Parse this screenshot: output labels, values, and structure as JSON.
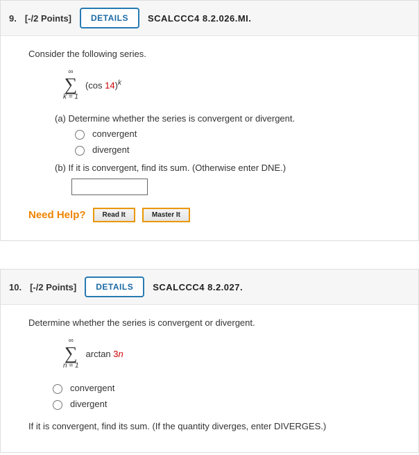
{
  "q9": {
    "number": "9.",
    "points": "[-/2 Points]",
    "details": "DETAILS",
    "ref": "SCALCCC4 8.2.026.MI.",
    "prompt": "Consider the following series.",
    "sigma": {
      "top": "∞",
      "bottom": "k = 1"
    },
    "expr_prefix": "(cos ",
    "expr_num": "14",
    "expr_suffix": ")",
    "expr_sup": "k",
    "partA": "(a) Determine whether the series is convergent or divergent.",
    "optConv": "convergent",
    "optDiv": "divergent",
    "partB": "(b) If it is convergent, find its sum. (Otherwise enter DNE.)",
    "needHelp": "Need Help?",
    "readIt": "Read It",
    "masterIt": "Master It"
  },
  "q10": {
    "number": "10.",
    "points": "[-/2 Points]",
    "details": "DETAILS",
    "ref": "SCALCCC4 8.2.027.",
    "prompt": "Determine whether the series is convergent or divergent.",
    "sigma": {
      "top": "∞",
      "bottom": "n = 1"
    },
    "expr_prefix": "arctan ",
    "expr_num": "3",
    "expr_var": "n",
    "optConv": "convergent",
    "optDiv": "divergent",
    "after": "If it is convergent, find its sum. (If the quantity diverges, enter DIVERGES.)"
  }
}
